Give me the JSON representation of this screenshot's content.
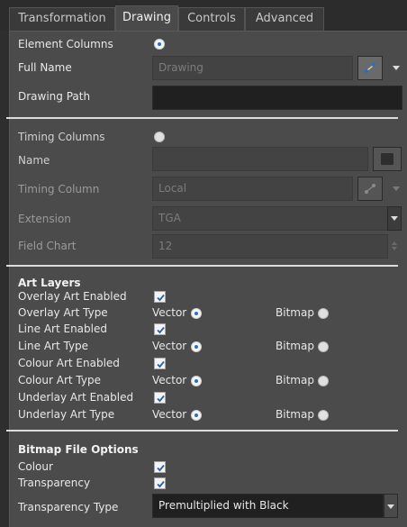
{
  "tabs": [
    {
      "label": "Transformation",
      "active": false
    },
    {
      "label": "Drawing",
      "active": true
    },
    {
      "label": "Controls",
      "active": false
    },
    {
      "label": "Advanced",
      "active": false
    }
  ],
  "element": {
    "columns_label": "Element Columns",
    "columns_selected": true,
    "full_name_label": "Full Name",
    "full_name_value": "Drawing",
    "drawing_path_label": "Drawing Path",
    "drawing_path_value": ""
  },
  "timing": {
    "columns_label": "Timing Columns",
    "columns_selected": false,
    "name_label": "Name",
    "name_value": "",
    "timing_column_label": "Timing Column",
    "timing_column_value": "Local",
    "extension_label": "Extension",
    "extension_value": "TGA",
    "field_chart_label": "Field Chart",
    "field_chart_value": "12"
  },
  "art_layers": {
    "heading": "Art Layers",
    "vector_label": "Vector",
    "bitmap_label": "Bitmap",
    "overlay_enabled_label": "Overlay Art Enabled",
    "overlay_type_label": "Overlay Art Type",
    "line_enabled_label": "Line Art Enabled",
    "line_type_label": "Line Art Type",
    "colour_enabled_label": "Colour Art Enabled",
    "colour_type_label": "Colour Art Type",
    "underlay_enabled_label": "Underlay Art Enabled",
    "underlay_type_label": "Underlay Art Type",
    "overlay_enabled": true,
    "line_enabled": true,
    "colour_enabled": true,
    "underlay_enabled": true,
    "selected_type": "Vector"
  },
  "bitmap_options": {
    "heading": "Bitmap File Options",
    "colour_label": "Colour",
    "colour_checked": true,
    "transparency_label": "Transparency",
    "transparency_checked": true,
    "transparency_type_label": "Transparency Type",
    "transparency_type_value": "Premultiplied with Black"
  },
  "colors": {
    "panel_bg": "#4b4b4b",
    "accent_blue": "#2a70c0",
    "check_blue": "#2a5fb0"
  }
}
